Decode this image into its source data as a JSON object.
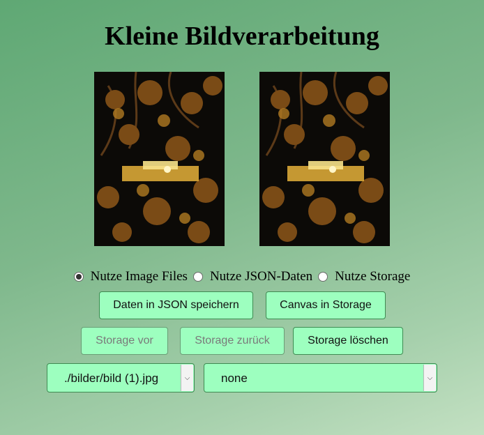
{
  "title": "Kleine Bildverarbeitung",
  "images": {
    "left_alt": "night scene photo",
    "right_alt": "night scene photo copy"
  },
  "radios": [
    {
      "label": "Nutze Image Files",
      "checked": true
    },
    {
      "label": "Nutze JSON-Daten",
      "checked": false
    },
    {
      "label": "Nutze Storage",
      "checked": false
    }
  ],
  "buttons": {
    "save_json": "Daten in JSON speichern",
    "canvas_storage": "Canvas in Storage",
    "storage_forward": "Storage vor",
    "storage_back": "Storage zurück",
    "storage_delete": "Storage löschen"
  },
  "selects": {
    "file_value": "./bilder/bild (1).jpg",
    "filter_value": "none"
  },
  "colors": {
    "button_bg": "#9dffbf",
    "button_border": "#3f8a52"
  }
}
